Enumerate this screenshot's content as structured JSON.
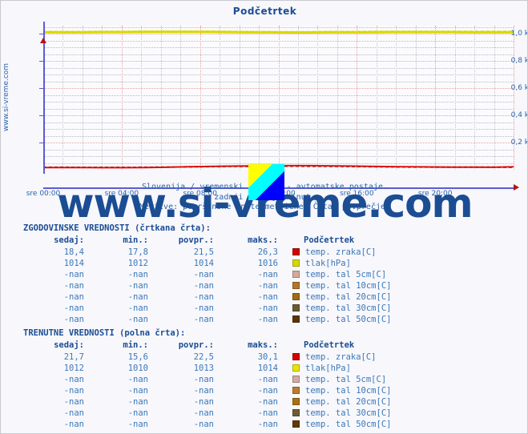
{
  "page": {
    "site_label": "www.si-vreme.com",
    "watermark": "www.si-vreme.com",
    "bg_color": "#f7f7fc",
    "accent_color": "#2a64a8"
  },
  "chart_header": {
    "title": "Podčetrtek"
  },
  "subtitle": {
    "line1": "Slovenija / vremenski podatki - avtomatske postaje.",
    "line2": "zadnji dan / 5 minut.",
    "line3": "Meritve: površinske enote metrične. Črta: povprečje."
  },
  "chart_data": {
    "type": "line",
    "title": "Podčetrtek",
    "xlabel": "",
    "ylabel": "",
    "ylim": [
      0,
      1060
    ],
    "xlim": [
      "sre 00:00",
      "sre 23:55"
    ],
    "grid": true,
    "legend_position": "below-table",
    "y_ticks": [
      {
        "value": 200,
        "label": "0,2 k"
      },
      {
        "value": 400,
        "label": "0,4 k"
      },
      {
        "value": 600,
        "label": "0,6 k"
      },
      {
        "value": 800,
        "label": "0,8 k"
      },
      {
        "value": 1000,
        "label": "1,0 k"
      }
    ],
    "x_ticks": [
      {
        "pos": 0,
        "label": "sre 00:00"
      },
      {
        "pos": 4,
        "label": "sre 04:00"
      },
      {
        "pos": 8,
        "label": "sre 08:00"
      },
      {
        "pos": 12,
        "label": "sre 12:00"
      },
      {
        "pos": 16,
        "label": "sre 16:00"
      },
      {
        "pos": 20,
        "label": "sre 20:00"
      }
    ],
    "series": [
      {
        "name": "tlak[hPa] (zgodovinske)",
        "style": "dashed",
        "color": "#e0e000",
        "level": 1014,
        "values": [
          1014,
          1013,
          1013,
          1014,
          1014,
          1015,
          1016,
          1016,
          1015,
          1014,
          1013,
          1012,
          1012,
          1012,
          1013,
          1013,
          1014,
          1014,
          1014,
          1014,
          1014,
          1014,
          1014,
          1014
        ]
      },
      {
        "name": "tlak[hPa] (trenutne)",
        "style": "solid",
        "color": "#d8d800",
        "level": 1013,
        "values": [
          1012,
          1012,
          1012,
          1013,
          1013,
          1014,
          1014,
          1014,
          1014,
          1013,
          1012,
          1011,
          1010,
          1010,
          1011,
          1012,
          1012,
          1013,
          1013,
          1013,
          1013,
          1012,
          1012,
          1012
        ]
      },
      {
        "name": "temp. zraka[C] (zgodovinske)",
        "style": "dashed",
        "color": "#8b1a1a",
        "level": 21.5,
        "values": [
          18.4,
          18.1,
          17.9,
          17.8,
          17.8,
          18.0,
          19.2,
          21.0,
          23.0,
          24.5,
          25.6,
          26.1,
          26.3,
          26.2,
          25.5,
          24.3,
          22.8,
          21.4,
          20.3,
          19.6,
          19.1,
          18.8,
          18.6,
          18.4
        ]
      },
      {
        "name": "temp. zraka[C] (trenutne)",
        "style": "solid",
        "color": "#e01010",
        "level": 22.5,
        "values": [
          16.5,
          16.1,
          15.8,
          15.6,
          15.6,
          16.2,
          18.4,
          21.5,
          24.3,
          26.4,
          28.1,
          29.4,
          30.1,
          29.9,
          28.8,
          27.0,
          25.0,
          23.2,
          21.6,
          20.4,
          19.4,
          18.6,
          18.0,
          21.7
        ]
      }
    ]
  },
  "logo": {
    "name": "si-vreme-logo",
    "colors": [
      "#ffff00",
      "#00ffff",
      "#0000ff"
    ]
  },
  "tables": [
    {
      "id": "historical",
      "caption": "ZGODOVINSKE VREDNOSTI (črtkana črta):",
      "headers": [
        "sedaj:",
        "min.:",
        "povpr.:",
        "maks.:",
        "Podčetrtek"
      ],
      "rows": [
        {
          "sedaj": "18,4",
          "min": "17,8",
          "povpr": "21,5",
          "maks": "26,3",
          "color": "#cc0000",
          "label": "temp. zraka[C]"
        },
        {
          "sedaj": "1014",
          "min": "1012",
          "povpr": "1014",
          "maks": "1016",
          "color": "#d8d800",
          "label": "tlak[hPa]"
        },
        {
          "sedaj": "-nan",
          "min": "-nan",
          "povpr": "-nan",
          "maks": "-nan",
          "color": "#d2aaa0",
          "label": "temp. tal  5cm[C]"
        },
        {
          "sedaj": "-nan",
          "min": "-nan",
          "povpr": "-nan",
          "maks": "-nan",
          "color": "#b2762a",
          "label": "temp. tal 10cm[C]"
        },
        {
          "sedaj": "-nan",
          "min": "-nan",
          "povpr": "-nan",
          "maks": "-nan",
          "color": "#a06a10",
          "label": "temp. tal 20cm[C]"
        },
        {
          "sedaj": "-nan",
          "min": "-nan",
          "povpr": "-nan",
          "maks": "-nan",
          "color": "#6b5a32",
          "label": "temp. tal 30cm[C]"
        },
        {
          "sedaj": "-nan",
          "min": "-nan",
          "povpr": "-nan",
          "maks": "-nan",
          "color": "#5a3408",
          "label": "temp. tal 50cm[C]"
        }
      ]
    },
    {
      "id": "current",
      "caption": "TRENUTNE VREDNOSTI (polna črta):",
      "headers": [
        "sedaj:",
        "min.:",
        "povpr.:",
        "maks.:",
        "Podčetrtek"
      ],
      "rows": [
        {
          "sedaj": "21,7",
          "min": "15,6",
          "povpr": "22,5",
          "maks": "30,1",
          "color": "#d40000",
          "label": "temp. zraka[C]"
        },
        {
          "sedaj": "1012",
          "min": "1010",
          "povpr": "1013",
          "maks": "1014",
          "color": "#e6e600",
          "label": "tlak[hPa]"
        },
        {
          "sedaj": "-nan",
          "min": "-nan",
          "povpr": "-nan",
          "maks": "-nan",
          "color": "#d4aaa4",
          "label": "temp. tal  5cm[C]"
        },
        {
          "sedaj": "-nan",
          "min": "-nan",
          "povpr": "-nan",
          "maks": "-nan",
          "color": "#bc7c2c",
          "label": "temp. tal 10cm[C]"
        },
        {
          "sedaj": "-nan",
          "min": "-nan",
          "povpr": "-nan",
          "maks": "-nan",
          "color": "#ab7010",
          "label": "temp. tal 20cm[C]"
        },
        {
          "sedaj": "-nan",
          "min": "-nan",
          "povpr": "-nan",
          "maks": "-nan",
          "color": "#6e5c34",
          "label": "temp. tal 30cm[C]"
        },
        {
          "sedaj": "-nan",
          "min": "-nan",
          "povpr": "-nan",
          "maks": "-nan",
          "color": "#613908",
          "label": "temp. tal 50cm[C]"
        }
      ]
    }
  ]
}
